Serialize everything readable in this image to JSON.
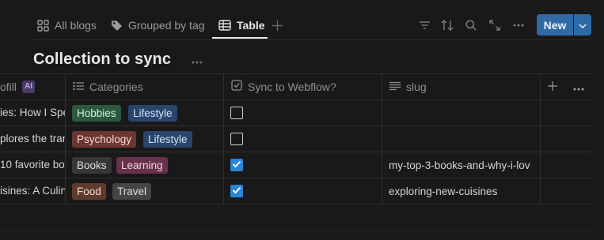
{
  "tabs": [
    {
      "label": "All blogs",
      "icon": "grid-icon"
    },
    {
      "label": "Grouped by tag",
      "icon": "tag-icon"
    },
    {
      "label": "Table",
      "icon": "table-icon",
      "active": true
    }
  ],
  "toolbar": {
    "new_label": "New",
    "icons": [
      "filter-icon",
      "sort-icon",
      "search-icon",
      "expand-icon",
      "more-icon"
    ]
  },
  "collection_title": "Collection to sync",
  "columns": [
    {
      "label": "ofill",
      "ai_badge": "AI"
    },
    {
      "label": "Categories",
      "icon": "list-icon"
    },
    {
      "label": "Sync to Webflow?",
      "icon": "checkbox-icon"
    },
    {
      "label": "slug",
      "icon": "text-icon"
    }
  ],
  "rows": [
    {
      "title": "ies: How I Spe",
      "tags": [
        {
          "label": "Hobbies"
        },
        {
          "label": "Lifestyle"
        }
      ],
      "sync": false,
      "slug": ""
    },
    {
      "title": "plores the tran",
      "tags": [
        {
          "label": "Psychology"
        },
        {
          "label": "Lifestyle"
        }
      ],
      "sync": false,
      "slug": ""
    },
    {
      "title": "10 favorite boo",
      "tags": [
        {
          "label": "Books"
        },
        {
          "label": "Learning"
        }
      ],
      "sync": true,
      "slug": "my-top-3-books-and-why-i-lov"
    },
    {
      "title": "isines: A Culin",
      "tags": [
        {
          "label": "Food"
        },
        {
          "label": "Travel"
        }
      ],
      "sync": true,
      "slug": "exploring-new-cuisines"
    }
  ],
  "tag_colors": {
    "Hobbies": "#2b593f",
    "Lifestyle": "#28456c",
    "Psychology": "#6e3630",
    "Books": "#373737",
    "Learning": "#69314c",
    "Food": "#603b2c",
    "Travel": "#454545"
  },
  "accent_color": "#2f6aa5"
}
